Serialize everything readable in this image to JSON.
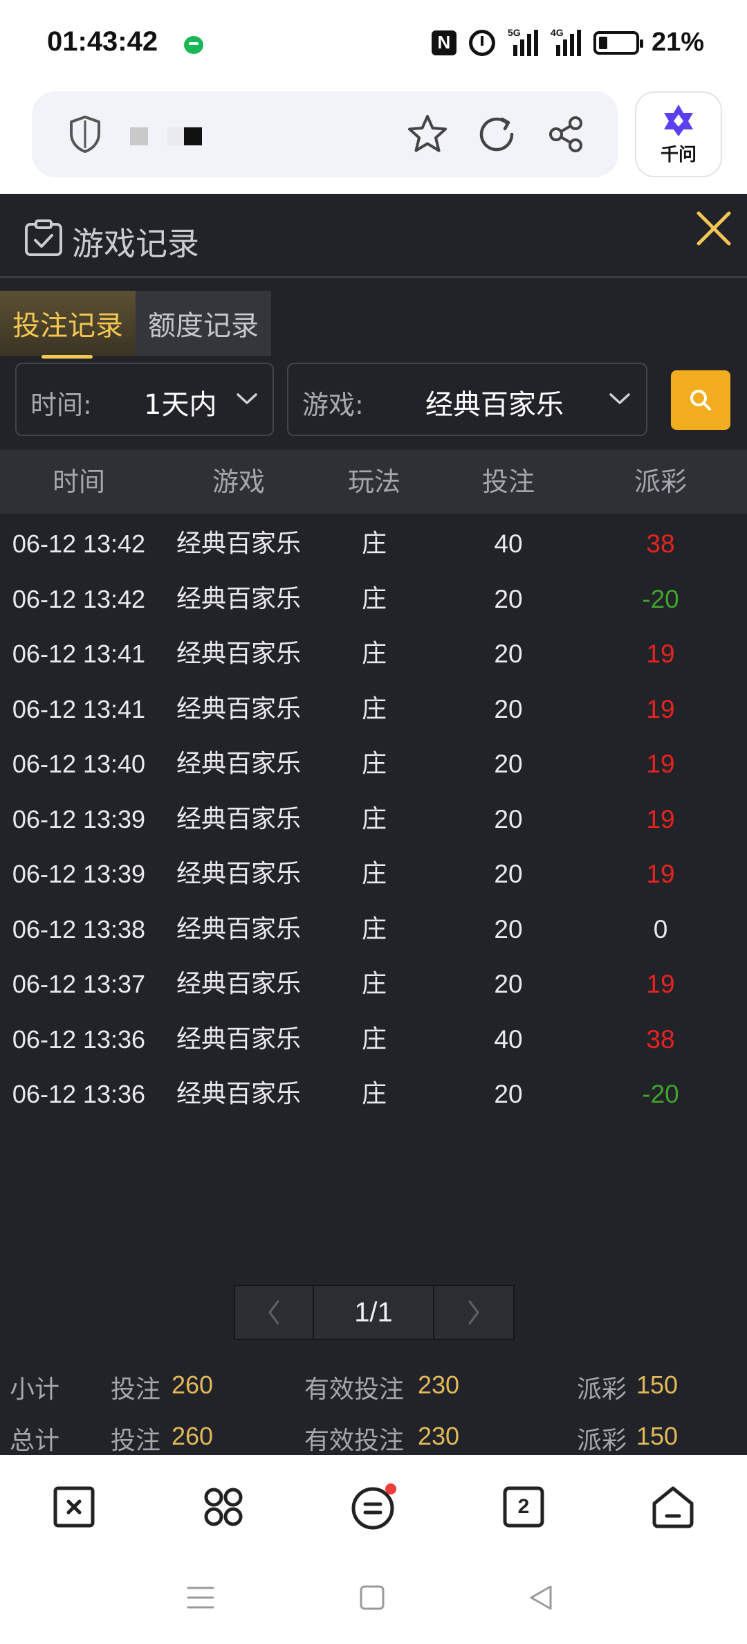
{
  "status_bar": {
    "time": "01:43:42",
    "signal1_tag": "5G",
    "signal2_tag": "4G",
    "nfc_label": "N",
    "battery_percent": "21%"
  },
  "browser": {
    "assistant_label": "千问"
  },
  "panel": {
    "title": "游戏记录",
    "tabs": [
      {
        "label": "投注记录",
        "active": true
      },
      {
        "label": "额度记录",
        "active": false
      }
    ],
    "filters": {
      "time_label": "时间:",
      "time_value": "1天内",
      "game_label": "游戏:",
      "game_value": "经典百家乐"
    },
    "columns": [
      "时间",
      "游戏",
      "玩法",
      "投注",
      "派彩"
    ],
    "rows": [
      {
        "time": "06-12 13:42",
        "game": "经典百家乐",
        "play": "庄",
        "bet": "40",
        "payout": "38",
        "payout_color": "#e8231f"
      },
      {
        "time": "06-12 13:42",
        "game": "经典百家乐",
        "play": "庄",
        "bet": "20",
        "payout": "-20",
        "payout_color": "#3ea42c"
      },
      {
        "time": "06-12 13:41",
        "game": "经典百家乐",
        "play": "庄",
        "bet": "20",
        "payout": "19",
        "payout_color": "#e8231f"
      },
      {
        "time": "06-12 13:41",
        "game": "经典百家乐",
        "play": "庄",
        "bet": "20",
        "payout": "19",
        "payout_color": "#e8231f"
      },
      {
        "time": "06-12 13:40",
        "game": "经典百家乐",
        "play": "庄",
        "bet": "20",
        "payout": "19",
        "payout_color": "#e8231f"
      },
      {
        "time": "06-12 13:39",
        "game": "经典百家乐",
        "play": "庄",
        "bet": "20",
        "payout": "19",
        "payout_color": "#e8231f"
      },
      {
        "time": "06-12 13:39",
        "game": "经典百家乐",
        "play": "庄",
        "bet": "20",
        "payout": "19",
        "payout_color": "#e8231f"
      },
      {
        "time": "06-12 13:38",
        "game": "经典百家乐",
        "play": "庄",
        "bet": "20",
        "payout": "0",
        "payout_color": "#eaeaec"
      },
      {
        "time": "06-12 13:37",
        "game": "经典百家乐",
        "play": "庄",
        "bet": "20",
        "payout": "19",
        "payout_color": "#e8231f"
      },
      {
        "time": "06-12 13:36",
        "game": "经典百家乐",
        "play": "庄",
        "bet": "40",
        "payout": "38",
        "payout_color": "#e8231f"
      },
      {
        "time": "06-12 13:36",
        "game": "经典百家乐",
        "play": "庄",
        "bet": "20",
        "payout": "-20",
        "payout_color": "#3ea42c"
      }
    ],
    "pagination": {
      "current": "1/1"
    },
    "subtotal": {
      "label": "小计",
      "bet_label": "投注",
      "bet": "260",
      "valid_label": "有效投注",
      "valid": "230",
      "payout_label": "派彩",
      "payout": "150"
    },
    "total": {
      "label": "总计",
      "bet_label": "投注",
      "bet": "260",
      "valid_label": "有效投注",
      "valid": "230",
      "payout_label": "派彩",
      "payout": "150"
    }
  },
  "bottom_nav": {
    "tab_count": "2",
    "icons": [
      "close-tab-icon",
      "apps-icon",
      "menu-icon",
      "tabs-icon",
      "home-icon"
    ]
  },
  "colors": {
    "accent": "#f4c653",
    "panel_bg": "#212329",
    "win": "#e8231f",
    "loss": "#3ea42c",
    "search": "#f2ad1f"
  }
}
